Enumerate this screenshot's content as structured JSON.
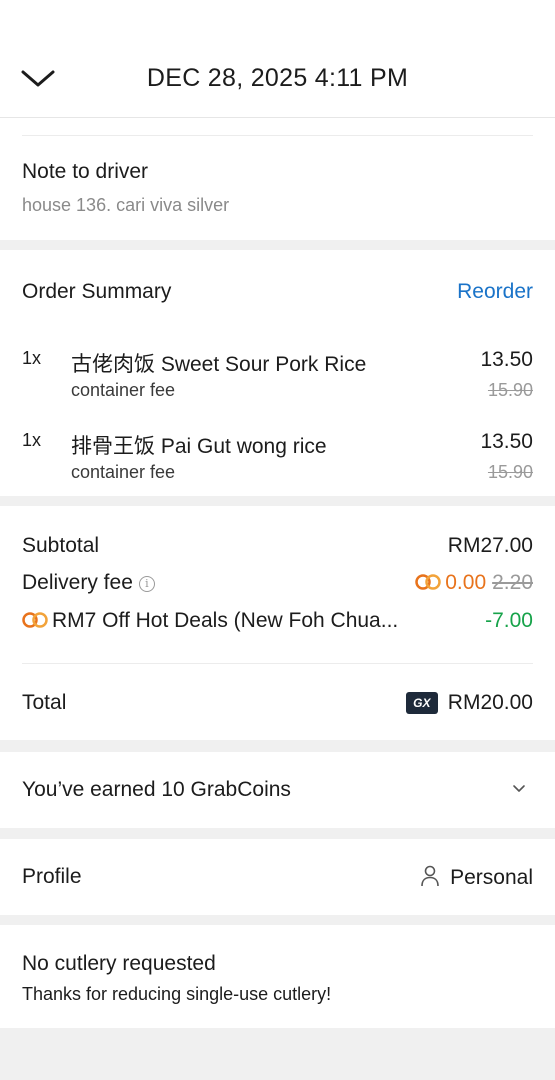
{
  "header": {
    "title": "DEC 28, 2025 4:11 PM",
    "back_icon": "chevron-down-icon"
  },
  "note": {
    "title": "Note to driver",
    "text": "house 136. cari viva silver"
  },
  "order_summary": {
    "title": "Order Summary",
    "reorder_label": "Reorder",
    "items": [
      {
        "qty": "1x",
        "name": "古佬肉饭 Sweet Sour Pork Rice",
        "sub": "container fee",
        "price": "13.50",
        "old_price": "15.90"
      },
      {
        "qty": "1x",
        "name": "排骨王饭 Pai Gut wong rice",
        "sub": "container fee",
        "price": "13.50",
        "old_price": "15.90"
      }
    ]
  },
  "totals": {
    "subtotal_label": "Subtotal",
    "subtotal_value": "RM27.00",
    "delivery_label": "Delivery fee",
    "delivery_value": "0.00",
    "delivery_old": "2.20",
    "promo_label": "RM7 Off Hot Deals (New Foh Chua...",
    "promo_value": "-7.00",
    "total_label": "Total",
    "total_badge": "GX",
    "total_value": "RM20.00"
  },
  "coins": {
    "label": "You’ve earned 10 GrabCoins",
    "icon": "chevron-down-icon"
  },
  "profile": {
    "label": "Profile",
    "value": "Personal",
    "icon": "person-icon"
  },
  "cutlery": {
    "title": "No cutlery requested",
    "subtitle": "Thanks for reducing single-use cutlery!"
  },
  "colors": {
    "accent_blue": "#1a73c8",
    "orange": "#e8731c",
    "green": "#17a34a",
    "background": "#f0f0f0"
  }
}
